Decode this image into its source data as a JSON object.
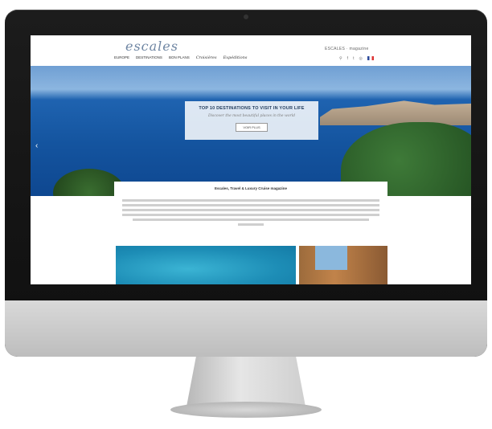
{
  "site": {
    "logo": "escales",
    "brand_right": "ESCALES · magazine",
    "nav": [
      "EUROPE",
      "DESTINATIONS",
      "BON PLANS",
      "Croisières",
      "Expéditions"
    ],
    "nav_icons": [
      "search-icon",
      "facebook-icon",
      "twitter-icon",
      "instagram-icon",
      "flag-icon"
    ]
  },
  "hero": {
    "title": "TOP 10 DESTINATIONS TO VISIT IN YOUR LIFE",
    "subtitle": "Discover the most beautiful places in the world",
    "button": "VOIR PLUS",
    "prev_arrow": "‹"
  },
  "intro": {
    "title": "Escales, Travel & Luxury Cruise magazine",
    "line_count": 6
  }
}
